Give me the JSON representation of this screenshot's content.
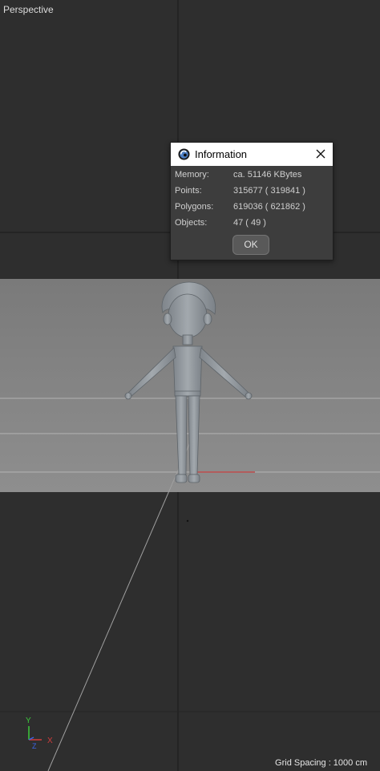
{
  "viewport": {
    "label": "Perspective",
    "grid_spacing": "Grid Spacing : 1000 cm",
    "colors": {
      "background": "#2e2e2e",
      "floor": "#8a8a8a",
      "model": "#9aa0a6",
      "axis_x": "#d23c3c",
      "axis_y": "#3cc83c",
      "axis_z": "#3c64e6"
    }
  },
  "axis_gizmo": {
    "x": "X",
    "y": "Y",
    "z": "Z"
  },
  "dialog": {
    "title": "Information",
    "icon": "cinema4d-logo-icon",
    "rows": [
      {
        "label": "Memory:",
        "value": "ca. 51146 KBytes"
      },
      {
        "label": "Points:",
        "value": "315677 ( 319841 )"
      },
      {
        "label": "Polygons:",
        "value": "619036 ( 621862 )"
      },
      {
        "label": "Objects:",
        "value": "47 ( 49 )"
      }
    ],
    "ok_label": "OK",
    "close_icon": "close-icon"
  }
}
